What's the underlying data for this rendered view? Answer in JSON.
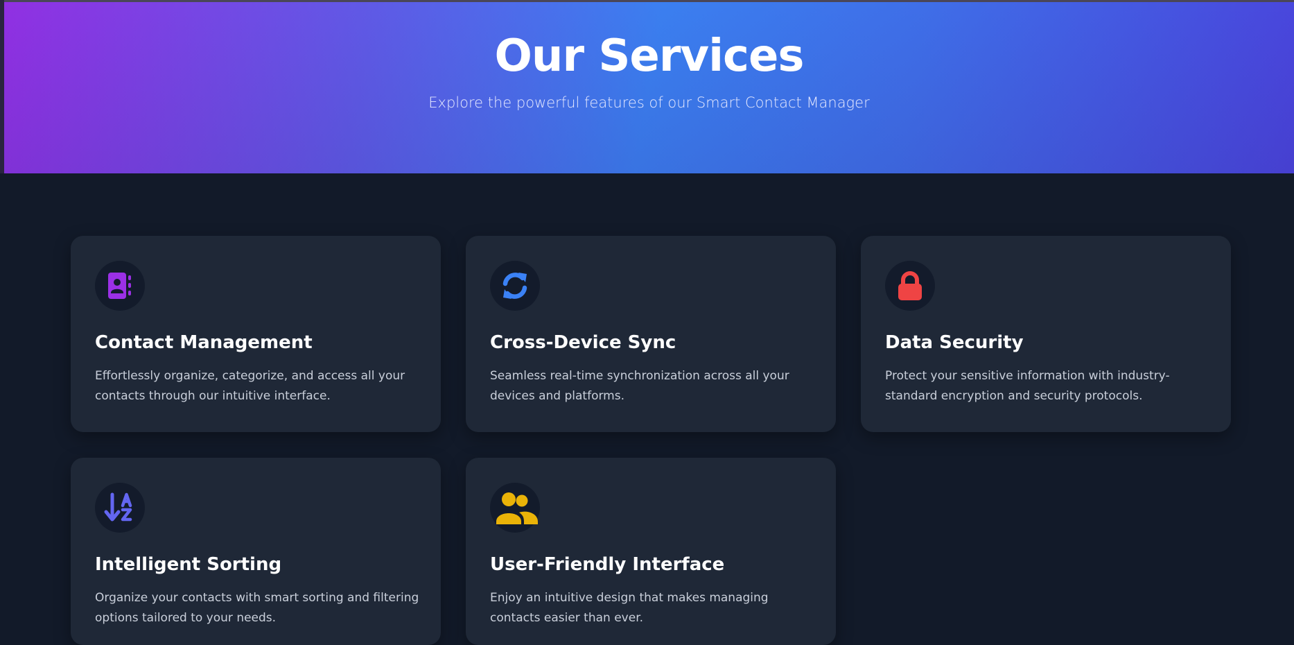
{
  "hero": {
    "title": "Our Services",
    "subtitle": "Explore the powerful features of our Smart Contact Manager"
  },
  "services": [
    {
      "icon": "address-book-icon",
      "icon_color": "#9b30e6",
      "title": "Contact Management",
      "description": "Effortlessly organize, categorize, and access all your contacts through our intuitive interface."
    },
    {
      "icon": "sync-icon",
      "icon_color": "#3b82f6",
      "title": "Cross-Device Sync",
      "description": "Seamless real-time synchronization across all your devices and platforms."
    },
    {
      "icon": "lock-icon",
      "icon_color": "#ef4444",
      "title": "Data Security",
      "description": "Protect your sensitive information with industry-standard encryption and security protocols."
    },
    {
      "icon": "sort-alpha-icon",
      "icon_color": "#6366f1",
      "title": "Intelligent Sorting",
      "description": "Organize your contacts with smart sorting and filtering options tailored to your needs."
    },
    {
      "icon": "users-icon",
      "icon_color": "#eab308",
      "title": "User-Friendly Interface",
      "description": "Enjoy an intuitive design that makes managing contacts easier than ever."
    }
  ],
  "colors": {
    "background": "#121a29",
    "card": "#1f2837",
    "hero_gradient": [
      "#9130e3",
      "#3b7ff0",
      "#4a44dc"
    ]
  }
}
